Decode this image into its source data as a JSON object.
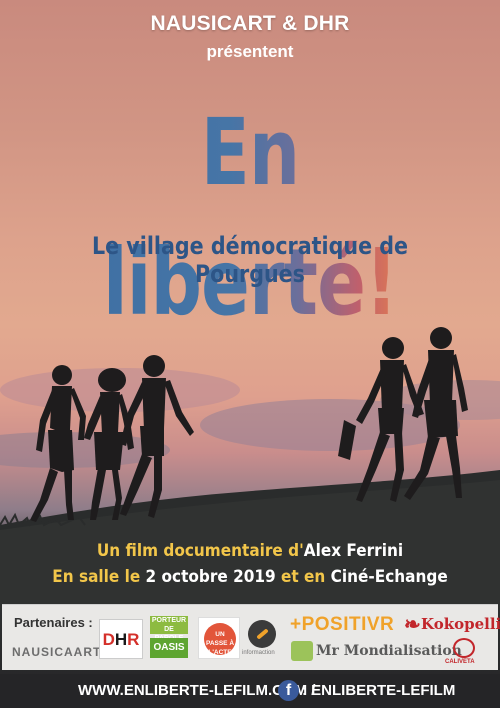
{
  "header": {
    "presenters": "NAUSICART & DHR",
    "presents": "présentent"
  },
  "title": "En liberté!",
  "subtitle": "Le village démocratique de Pourgues",
  "credits": {
    "line1_prefix": "Un film documentaire d'",
    "director": "Alex Ferrini",
    "line2_prefix": "En salle le ",
    "date": "2 octobre 2019",
    "line2_mid": " et en ",
    "venue": "Ciné-Echange"
  },
  "partners": {
    "label": "Partenaires :",
    "logos": {
      "nausicaart": "NAUSICAART",
      "dhr_d": "D",
      "dhr_h": "H",
      "dhr_r": "R",
      "porteur": "PORTEUR DE PAROLE",
      "oasis": "OASIS",
      "unpasse": "UN PASSE À L'ACTE",
      "informaction": "informaction",
      "positivr": "+POSITIVR",
      "mrmondialisation": "Mr Mondialisation",
      "kokopelli": "Kokopelli",
      "caliveta": "CALIVETA"
    }
  },
  "footer": {
    "website": "WWW.ENLIBERTE-LEFILM.COM /",
    "facebook_icon": "f",
    "facebook": ": ENLIBERTE-LEFILM"
  },
  "colors": {
    "title_gradient_start": "#3e6fa3",
    "title_gradient_end": "#f3a348",
    "subtitle": "#2d5587",
    "credits": "#f2c64a",
    "footer_bg": "#252527",
    "partners_bg": "#e9e8e6",
    "kokopelli": "#c2262b",
    "positivr": "#f0a22a"
  }
}
